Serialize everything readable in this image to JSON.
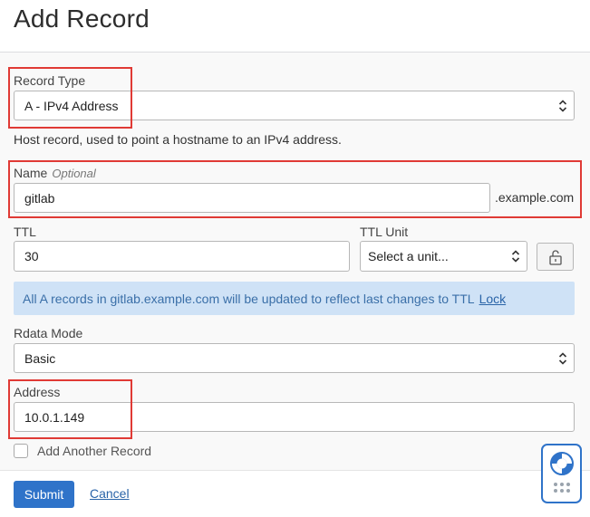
{
  "title": "Add Record",
  "record_type": {
    "label": "Record Type",
    "value": "A - IPv4 Address",
    "help": "Host record, used to point a hostname to an IPv4 address."
  },
  "name": {
    "label": "Name",
    "optional": "Optional",
    "value": "gitlab",
    "suffix": ".example.com"
  },
  "ttl": {
    "label": "TTL",
    "value": "30"
  },
  "ttl_unit": {
    "label": "TTL Unit",
    "value": "Select a unit..."
  },
  "banner": {
    "text": "All A records in gitlab.example.com will be updated to reflect last changes to TTL",
    "link": "Lock"
  },
  "rdata_mode": {
    "label": "Rdata Mode",
    "value": "Basic"
  },
  "address": {
    "label": "Address",
    "value": "10.0.1.149"
  },
  "add_another": {
    "label": "Add Another Record",
    "checked": false
  },
  "actions": {
    "submit": "Submit",
    "cancel": "Cancel"
  },
  "colors": {
    "accent": "#2f73c9",
    "highlight": "#e03a35",
    "banner_bg": "#cfe2f6",
    "banner_text": "#3a6fa8"
  },
  "icons": {
    "select_arrows": "chevron-updown-icon",
    "lock": "unlock-icon",
    "help_widget": "lifebuoy-icon"
  }
}
